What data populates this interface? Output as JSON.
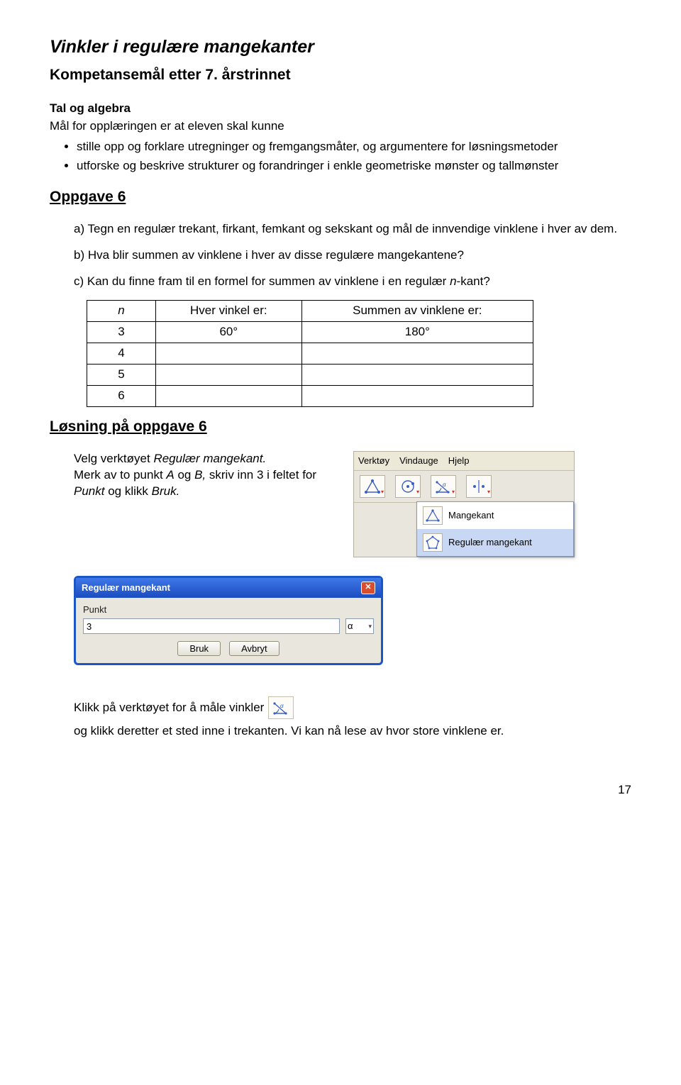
{
  "title": "Vinkler i regulære mangekanter",
  "subtitle": "Kompetansemål etter 7. årstrinnet",
  "section": {
    "head": "Tal og algebra",
    "sub": "Mål for opplæringen er at eleven skal kunne",
    "bullets": [
      "stille opp og forklare utregninger og fremgangsmåter, og argumentere for løsningsmetoder",
      "utforske og beskrive strukturer og forandringer i enkle geometriske mønster og tallmønster"
    ]
  },
  "oppgave": {
    "heading": "Oppgave 6",
    "a": "a) Tegn en regulær trekant, firkant, femkant og sekskant og mål de innvendige vinklene i hver av dem.",
    "b": "b)  Hva blir summen av vinklene i hver av disse regulære mangekantene?",
    "c_pre": "c)  Kan du finne fram til en formel for summen av vinklene i en regulær ",
    "c_ital": "n",
    "c_post": "-kant?"
  },
  "table": {
    "h_n": "n",
    "h_each": "Hver vinkel er:",
    "h_sum": "Summen av vinklene er:",
    "rows": [
      {
        "n": "3",
        "each": "60°",
        "sum": "180°"
      },
      {
        "n": "4",
        "each": "",
        "sum": ""
      },
      {
        "n": "5",
        "each": "",
        "sum": ""
      },
      {
        "n": "6",
        "each": "",
        "sum": ""
      }
    ]
  },
  "losning": {
    "heading": "Løsning på oppgave 6",
    "velg_pre": "Velg verktøyet ",
    "velg_ital": "Regulær mangekant.",
    "merk_pre": "Merk av to punkt ",
    "merk_i1": "A",
    "merk_mid1": " og ",
    "merk_i2": "B,",
    "merk_mid2": " skriv inn 3 i feltet for ",
    "merk_i3": "Punkt",
    "merk_mid3": " og klikk ",
    "merk_i4": "Bruk."
  },
  "dialog": {
    "title": "Regulær mangekant",
    "label": "Punkt",
    "value": "3",
    "alpha": "α",
    "bruk": "Bruk",
    "avbryt": "Avbryt"
  },
  "menu": {
    "verktoy": "Verktøy",
    "vindauge": "Vindauge",
    "hjelp": "Hjelp",
    "mangekant": "Mangekant",
    "regular": "Regulær mangekant"
  },
  "klikk": {
    "p1": "Klikk på verktøyet for å måle vinkler",
    "p2": "og klikk deretter et sted inne i trekanten. Vi kan nå lese av hvor store vinklene er."
  },
  "page": "17"
}
